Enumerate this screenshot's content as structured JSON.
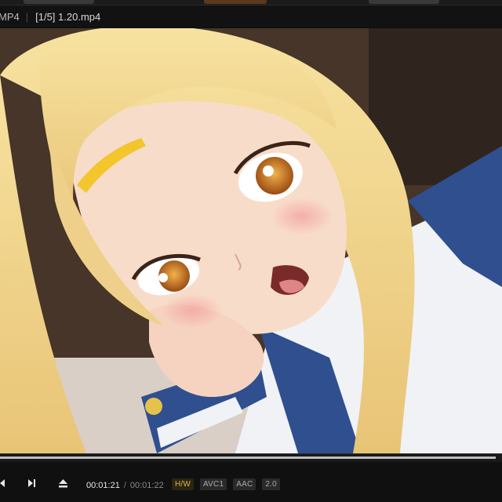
{
  "titlebar": {
    "format_label": "MP4",
    "file_label": "[1/5] 1.20.mp4"
  },
  "playback": {
    "current_time": "00:01:21",
    "separator": "/",
    "duration": "00:01:22",
    "progress": 0.988,
    "badges": [
      "H/W",
      "AVC1",
      "AAC",
      "2.0"
    ]
  },
  "colors": {
    "accent_hw": "#e2b43a",
    "control_bg": "#101010"
  },
  "icons": {
    "prev": "skip-previous-icon",
    "next": "skip-next-icon",
    "eject": "eject-icon"
  }
}
